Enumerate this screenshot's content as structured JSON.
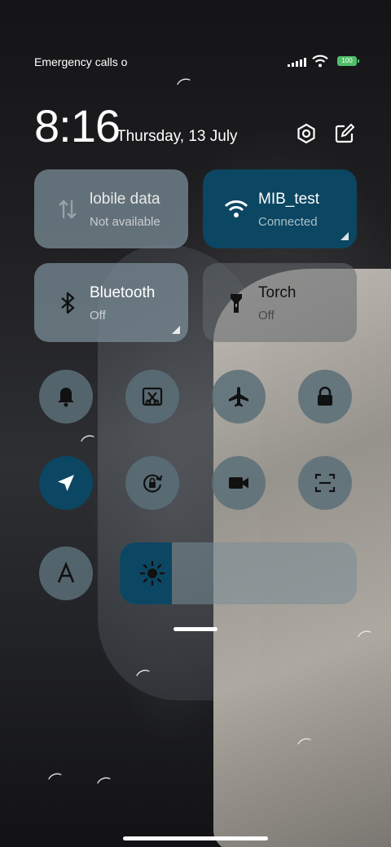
{
  "status_bar": {
    "carrier_text": "Emergency calls o",
    "battery": "100"
  },
  "clock": {
    "time": "8:16",
    "date": "Thursday, 13 July"
  },
  "header_icons": [
    "settings-icon",
    "edit-icon"
  ],
  "tiles": [
    {
      "name": "lobile data",
      "sub": "Not available",
      "icon": "mobile-data-icon",
      "state": "off"
    },
    {
      "name": "MIB_test",
      "sub": "Connected",
      "icon": "wifi-icon",
      "state": "on"
    },
    {
      "name": "Bluetooth",
      "sub": "Off",
      "icon": "bluetooth-icon",
      "state": "off"
    },
    {
      "name": "Torch",
      "sub": "Off",
      "icon": "torch-icon",
      "state": "off"
    }
  ],
  "toggles": [
    {
      "icon": "bell-icon",
      "state": "off"
    },
    {
      "icon": "screenshot-icon",
      "state": "off"
    },
    {
      "icon": "airplane-icon",
      "state": "off"
    },
    {
      "icon": "lock-icon",
      "state": "off"
    },
    {
      "icon": "location-icon",
      "state": "on"
    },
    {
      "icon": "rotation-lock-icon",
      "state": "off"
    },
    {
      "icon": "video-camera-icon",
      "state": "off"
    },
    {
      "icon": "scanner-icon",
      "state": "off"
    },
    {
      "icon": "font-icon",
      "state": "off"
    }
  ],
  "brightness": {
    "level": 0.22
  },
  "colors": {
    "active": "#0b4662",
    "inactive": "#768892"
  }
}
